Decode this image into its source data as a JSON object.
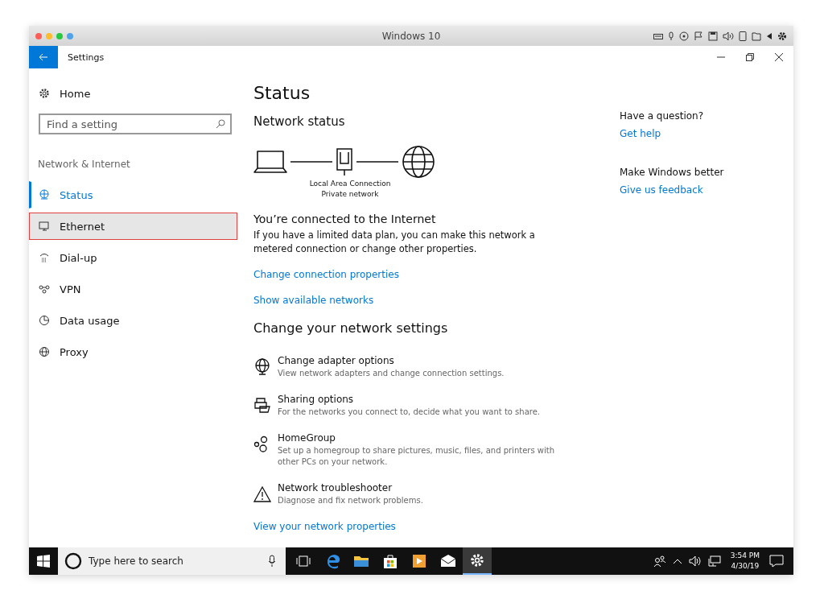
{
  "window": {
    "title": "Windows 10"
  },
  "app": {
    "title": "Settings"
  },
  "sidebar": {
    "home": "Home",
    "search": {
      "placeholder": "Find a setting"
    },
    "section": "Network & Internet",
    "items": [
      {
        "kind": "status",
        "label": "Status",
        "selected": true,
        "highlighted": false
      },
      {
        "kind": "ethernet",
        "label": "Ethernet",
        "selected": false,
        "highlighted": true
      },
      {
        "kind": "dialup",
        "label": "Dial-up",
        "selected": false,
        "highlighted": false
      },
      {
        "kind": "vpn",
        "label": "VPN",
        "selected": false,
        "highlighted": false
      },
      {
        "kind": "data",
        "label": "Data usage",
        "selected": false,
        "highlighted": false
      },
      {
        "kind": "proxy",
        "label": "Proxy",
        "selected": false,
        "highlighted": false
      }
    ]
  },
  "main": {
    "title": "Status",
    "subtitle": "Network status",
    "connection_name": "Local Area Connection",
    "connection_type": "Private network",
    "connected_heading": "You’re connected to the Internet",
    "connected_text": "If you have a limited data plan, you can make this network a metered connection or change other properties.",
    "links": [
      "Change connection properties",
      "Show available networks"
    ],
    "settings_heading": "Change your network settings",
    "settings": [
      {
        "kind": "adapter",
        "title": "Change adapter options",
        "desc": "View network adapters and change connection settings."
      },
      {
        "kind": "sharing",
        "title": "Sharing options",
        "desc": "For the networks you connect to, decide what you want to share."
      },
      {
        "kind": "homegroup",
        "title": "HomeGroup",
        "desc": "Set up a homegroup to share pictures, music, files, and printers with other PCs on your network."
      },
      {
        "kind": "troubleshooter",
        "title": "Network troubleshooter",
        "desc": "Diagnose and fix network problems."
      }
    ],
    "bottom_link": "View your network properties"
  },
  "aside": [
    {
      "heading": "Have a question?",
      "link": "Get help"
    },
    {
      "heading": "Make Windows better",
      "link": "Give us feedback"
    }
  ],
  "taskbar": {
    "search": {
      "placeholder": "Type here to search"
    },
    "apps": [
      {
        "kind": "taskview",
        "active": false
      },
      {
        "kind": "edge",
        "active": false
      },
      {
        "kind": "explorer",
        "active": false
      },
      {
        "kind": "store",
        "active": false
      },
      {
        "kind": "media",
        "active": false
      },
      {
        "kind": "mail",
        "active": false
      },
      {
        "kind": "settings",
        "active": true
      }
    ],
    "time": "3:54 PM",
    "date": "4/30/19"
  }
}
